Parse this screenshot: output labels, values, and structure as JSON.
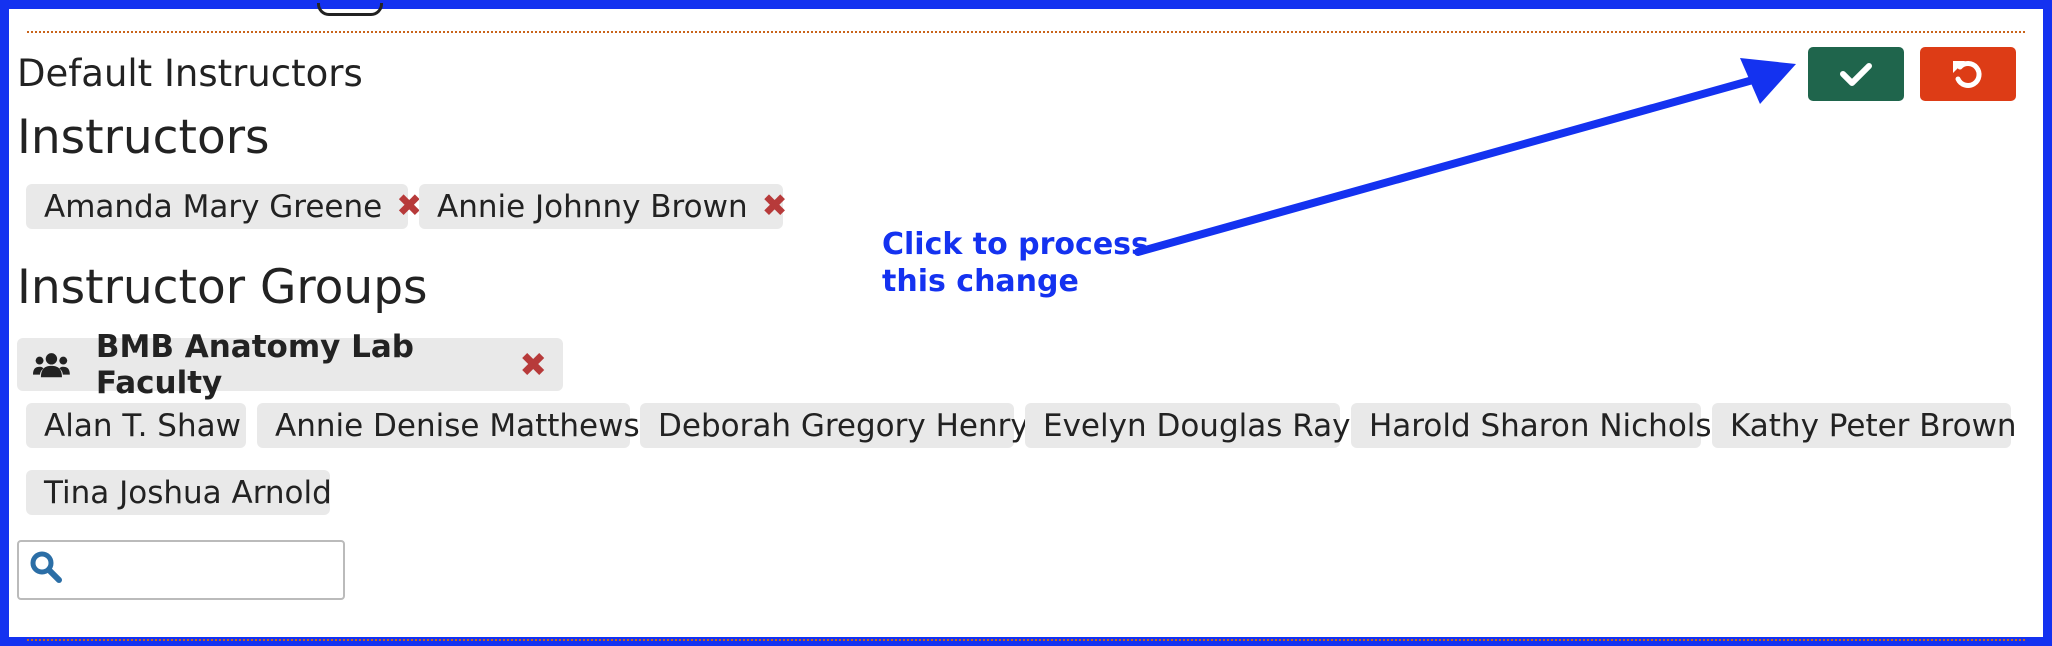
{
  "section": {
    "label": "Default Instructors"
  },
  "instructors": {
    "heading": "Instructors",
    "items": [
      {
        "name": "Amanda Mary Greene",
        "remove": "✖"
      },
      {
        "name": "Annie Johnny Brown",
        "remove": "✖"
      }
    ]
  },
  "instructor_groups": {
    "heading": "Instructor Groups",
    "group": {
      "icon": "users-icon",
      "name": "BMB Anatomy Lab Faculty",
      "remove": "✖"
    },
    "members": [
      "Alan T. Shaw",
      "Annie Denise Matthews",
      "Deborah Gregory Henry",
      "Evelyn Douglas Ray",
      "Harold Sharon Nichols",
      "Kathy Peter Brown",
      "Tina Joshua Arnold"
    ]
  },
  "search": {
    "value": "",
    "placeholder": "",
    "icon": "search-icon"
  },
  "actions": {
    "save_icon": "check-icon",
    "cancel_icon": "undo-icon",
    "save_color": "#1f654c",
    "cancel_color": "#dd3c16"
  },
  "annotation": {
    "line1": "Click to process",
    "line2": "this change",
    "color": "#1432f0"
  }
}
